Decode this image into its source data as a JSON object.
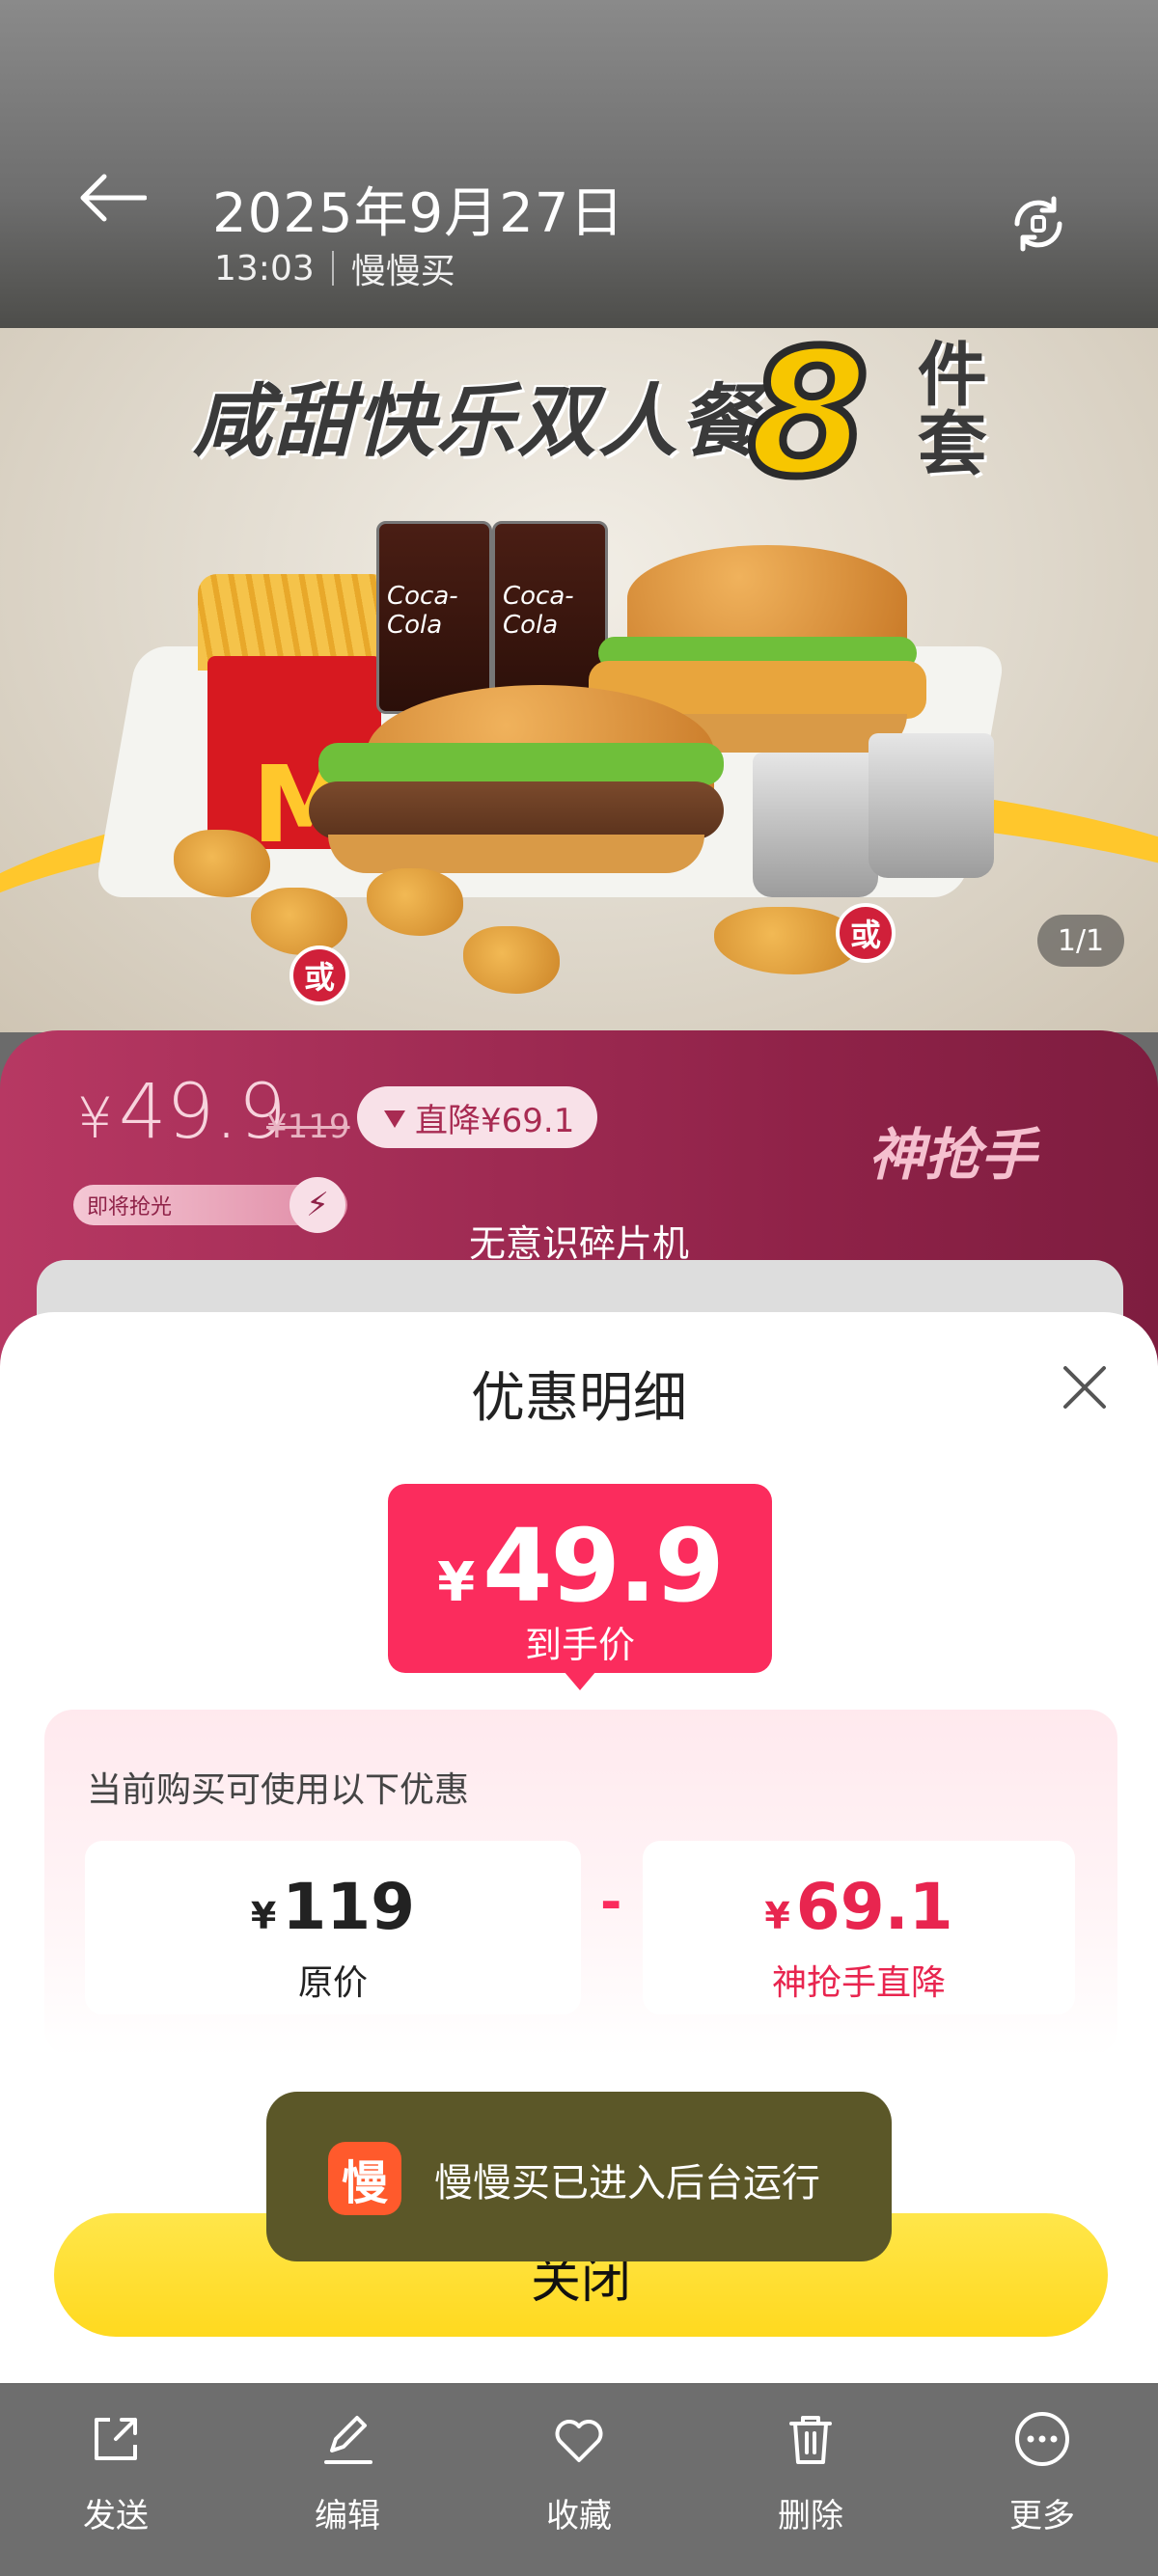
{
  "header": {
    "date": "2025年9月27日",
    "time": "13:03",
    "app_name": "慢慢买"
  },
  "photo": {
    "promo_title": "咸甜快乐双人餐",
    "promo_count": "8",
    "promo_suffix": "件套",
    "cola_text": "Coca-Cola",
    "or_label": "或",
    "page_indicator": "1/1",
    "logo_letter": "M"
  },
  "price_strip": {
    "currency": "¥",
    "price": "49.9",
    "original": "¥119",
    "drop": "直降¥69.1",
    "badge": "神抢手",
    "soon_label": "即将抢光",
    "shredder_label": "无意识碎片机"
  },
  "sheet": {
    "title": "优惠明细",
    "final_currency": "¥",
    "final_price": "49.9",
    "final_label": "到手价",
    "detail_heading": "当前购买可使用以下优惠",
    "original_currency": "¥",
    "original_value": "119",
    "original_label": "原价",
    "minus": "-",
    "discount_currency": "¥",
    "discount_value": "69.1",
    "discount_label": "神抢手直降",
    "close_label": "关闭"
  },
  "toast": {
    "icon_char": "慢",
    "message": "慢慢买已进入后台运行"
  },
  "toolbar": {
    "items": [
      {
        "label": "发送",
        "icon": "share-icon"
      },
      {
        "label": "编辑",
        "icon": "edit-icon"
      },
      {
        "label": "收藏",
        "icon": "heart-icon"
      },
      {
        "label": "删除",
        "icon": "trash-icon"
      },
      {
        "label": "更多",
        "icon": "more-icon"
      }
    ]
  },
  "colors": {
    "accent_red": "#fb2c5d",
    "close_yellow": "#ffd91f",
    "strip_magenta": "#8f2248"
  }
}
